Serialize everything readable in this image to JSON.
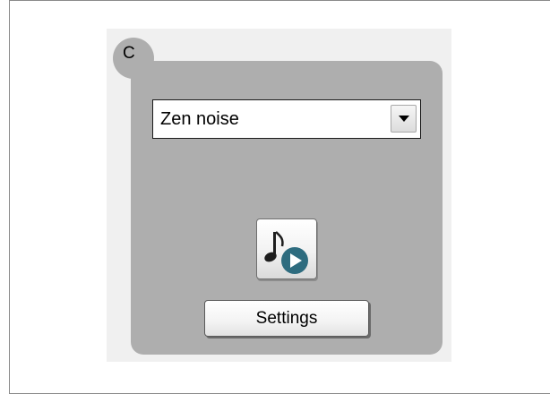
{
  "panel": {
    "badge_label": "C"
  },
  "sound_select": {
    "selected_value": "Zen noise"
  },
  "play_button": {
    "icon": "music-note-play-icon"
  },
  "settings_button": {
    "label": "Settings"
  },
  "colors": {
    "panel_gray": "#aeaeae",
    "play_circle": "#2e6c7f",
    "outer_panel": "#f0f0f0"
  }
}
